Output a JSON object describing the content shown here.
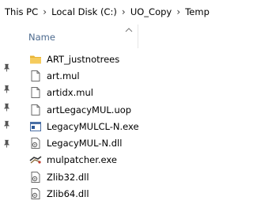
{
  "address_bar": {
    "crumbs": [
      "This PC",
      "Local Disk (C:)",
      "UO_Copy",
      "Temp"
    ],
    "separator": "›"
  },
  "column_header": {
    "name_label": "Name",
    "sort_icon": "chevron-up-icon"
  },
  "pins": [
    "pin-icon",
    "pin-icon",
    "pin-icon",
    "pin-icon",
    "pin-icon"
  ],
  "files": [
    {
      "name": "ART_justnotrees",
      "icon": "folder-icon"
    },
    {
      "name": "art.mul",
      "icon": "document-icon"
    },
    {
      "name": "artidx.mul",
      "icon": "document-icon"
    },
    {
      "name": "artLegacyMUL.uop",
      "icon": "document-icon"
    },
    {
      "name": "LegacyMULCL-N.exe",
      "icon": "console-app-icon"
    },
    {
      "name": "LegacyMUL-N.dll",
      "icon": "dll-icon"
    },
    {
      "name": "mulpatcher.exe",
      "icon": "app-icon"
    },
    {
      "name": "Zlib32.dll",
      "icon": "dll-icon"
    },
    {
      "name": "Zlib64.dll",
      "icon": "dll-icon"
    }
  ],
  "colors": {
    "folder": "#f2c94c",
    "header_text": "#4c6a8e"
  }
}
